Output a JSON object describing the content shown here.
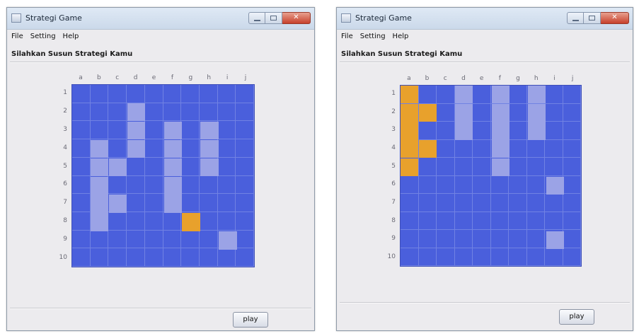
{
  "windows": [
    {
      "title": "Strategi Game",
      "menu": [
        "File",
        "Setting",
        "Help"
      ],
      "heading": "Silahkan Susun Strategi Kamu",
      "columns": [
        "a",
        "b",
        "c",
        "d",
        "e",
        "f",
        "g",
        "h",
        "i",
        "j"
      ],
      "rows": [
        "1",
        "2",
        "3",
        "4",
        "5",
        "6",
        "7",
        "8",
        "9",
        "10"
      ],
      "play_label": "play",
      "colors": {
        "water": "#4a5fdc",
        "placed_ship": "#9ba3e6",
        "selected_ship": "#e8a12c"
      },
      "ships": [
        {
          "state": "placed",
          "cells": [
            [
              "d",
              2
            ],
            [
              "d",
              3
            ],
            [
              "d",
              4
            ]
          ]
        },
        {
          "state": "placed",
          "cells": [
            [
              "f",
              3
            ],
            [
              "f",
              4
            ],
            [
              "f",
              5
            ],
            [
              "f",
              6
            ],
            [
              "f",
              7
            ]
          ]
        },
        {
          "state": "placed",
          "cells": [
            [
              "h",
              3
            ],
            [
              "h",
              4
            ],
            [
              "h",
              5
            ]
          ]
        },
        {
          "state": "placed",
          "cells": [
            [
              "b",
              4
            ],
            [
              "b",
              5
            ],
            [
              "b",
              6
            ],
            [
              "b",
              7
            ],
            [
              "b",
              8
            ],
            [
              "c",
              5
            ],
            [
              "c",
              7
            ]
          ]
        },
        {
          "state": "selected",
          "cells": [
            [
              "g",
              8
            ]
          ]
        },
        {
          "state": "placed",
          "cells": [
            [
              "i",
              9
            ]
          ]
        }
      ]
    },
    {
      "title": "Strategi Game",
      "menu": [
        "File",
        "Setting",
        "Help"
      ],
      "heading": "Silahkan Susun Strategi Kamu",
      "columns": [
        "a",
        "b",
        "c",
        "d",
        "e",
        "f",
        "g",
        "h",
        "i",
        "j"
      ],
      "rows": [
        "1",
        "2",
        "3",
        "4",
        "5",
        "6",
        "7",
        "8",
        "9",
        "10"
      ],
      "play_label": "play",
      "colors": {
        "water": "#4a5fdc",
        "placed_ship": "#9ba3e6",
        "selected_ship": "#e8a12c"
      },
      "ships": [
        {
          "state": "selected",
          "cells": [
            [
              "a",
              1
            ],
            [
              "a",
              2
            ],
            [
              "a",
              3
            ],
            [
              "a",
              4
            ],
            [
              "a",
              5
            ],
            [
              "b",
              2
            ],
            [
              "b",
              4
            ]
          ]
        },
        {
          "state": "placed",
          "cells": [
            [
              "d",
              1
            ],
            [
              "d",
              2
            ],
            [
              "d",
              3
            ]
          ]
        },
        {
          "state": "placed",
          "cells": [
            [
              "f",
              1
            ],
            [
              "f",
              2
            ],
            [
              "f",
              3
            ],
            [
              "f",
              4
            ],
            [
              "f",
              5
            ]
          ]
        },
        {
          "state": "placed",
          "cells": [
            [
              "h",
              1
            ],
            [
              "h",
              2
            ],
            [
              "h",
              3
            ]
          ]
        },
        {
          "state": "placed",
          "cells": [
            [
              "i",
              6
            ]
          ]
        },
        {
          "state": "placed",
          "cells": [
            [
              "i",
              9
            ]
          ]
        }
      ]
    }
  ]
}
